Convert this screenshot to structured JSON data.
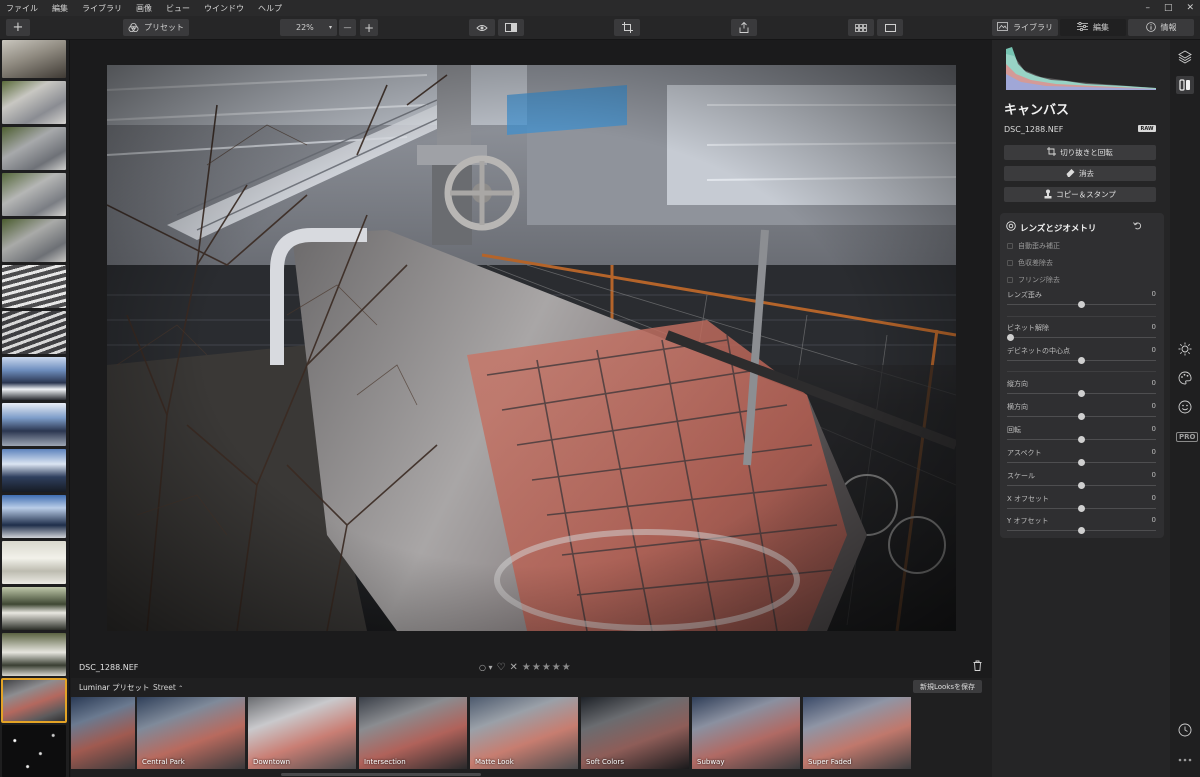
{
  "menu": [
    "ファイル",
    "編集",
    "ライブラリ",
    "画像",
    "ビュー",
    "ウインドウ",
    "ヘルプ"
  ],
  "window_controls": [
    "–",
    "□",
    "✕"
  ],
  "toolbar": {
    "add_label": "+",
    "presets_label": "プリセット",
    "zoom_value": "22%",
    "zoom_minus": "—",
    "zoom_plus": "+"
  },
  "tabs": [
    {
      "label": "ライブラリ",
      "icon": "library-icon"
    },
    {
      "label": "編集",
      "icon": "sliders-icon"
    },
    {
      "label": "情報",
      "icon": "info-icon"
    }
  ],
  "info_bar": {
    "filename": "DSC_1288.NEF",
    "flag_label": "○ ▾",
    "stars": "★★★★★"
  },
  "presets": {
    "label": "Luminar プリセット",
    "category": "Street",
    "save_label": "新規Looksを保存",
    "tiles": [
      "",
      "Central Park",
      "Downtown",
      "Intersection",
      "Matte Look",
      "Soft Colors",
      "Subway",
      "Super Faded"
    ]
  },
  "right_panel": {
    "title": "キャンバス",
    "filename": "DSC_1288.NEF",
    "raw_badge": "RAW",
    "buttons": [
      {
        "label": "切り抜きと回転",
        "icon": "crop-icon"
      },
      {
        "label": "消去",
        "icon": "eraser-icon"
      },
      {
        "label": "コピー＆スタンプ",
        "icon": "stamp-icon"
      }
    ],
    "tool": {
      "title": "レンズとジオメトリ",
      "checkboxes": [
        "自動歪み補正",
        "色収差除去",
        "フリンジ除去"
      ],
      "sliders": [
        {
          "label": "レンズ歪み",
          "value": "0",
          "level": 0.5
        },
        {
          "label": "ビネット解除",
          "value": "0",
          "level": 0.0
        },
        {
          "label": "デビネットの中心点",
          "value": "0",
          "level": 0.5
        },
        {
          "label": "縦方向",
          "value": "0",
          "level": 0.5
        },
        {
          "label": "横方向",
          "value": "0",
          "level": 0.5
        },
        {
          "label": "回転",
          "value": "0",
          "level": 0.5
        },
        {
          "label": "アスペクト",
          "value": "0",
          "level": 0.5
        },
        {
          "label": "スケール",
          "value": "0",
          "level": 0.5
        },
        {
          "label": "X オフセット",
          "value": "0",
          "level": 0.5
        },
        {
          "label": "Y オフセット",
          "value": "0",
          "level": 0.5
        }
      ]
    }
  },
  "side_icons": [
    "layers-icon",
    "canvas-tools-icon",
    "sun-icon",
    "palette-icon",
    "face-icon"
  ],
  "pro_badge": "PRO",
  "colors": {
    "accent": "#e3a326",
    "panel": "#252526",
    "tool_bg": "#2f2f31"
  }
}
